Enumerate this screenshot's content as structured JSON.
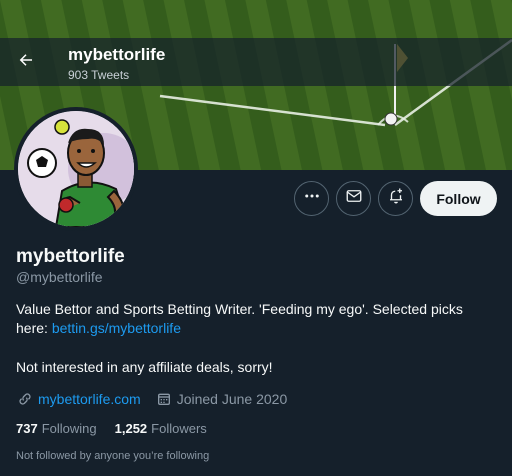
{
  "header": {
    "name": "mybettorlife",
    "tweet_count": "903 Tweets"
  },
  "profile": {
    "display_name": "mybettorlife",
    "handle": "@mybettorlife",
    "bio_text": "Value Bettor and Sports Betting Writer.  'Feeding my ego'. Selected picks here: ",
    "bio_link": "bettin.gs/mybettorlife",
    "bio_line2": "Not interested in any affiliate deals, sorry!",
    "website": "mybettorlife.com",
    "joined": "Joined June 2020",
    "following_count": "737",
    "following_label": "Following",
    "followers_count": "1,252",
    "followers_label": "Followers",
    "not_followed_text": "Not followed by anyone you’re following"
  },
  "actions": {
    "follow_label": "Follow",
    "more_icon": "more-icon",
    "message_icon": "envelope-icon",
    "notify_icon": "bell-plus-icon"
  },
  "colors": {
    "background": "#15202b",
    "accent": "#1d9bf0",
    "secondary_text": "#8b98a5"
  }
}
